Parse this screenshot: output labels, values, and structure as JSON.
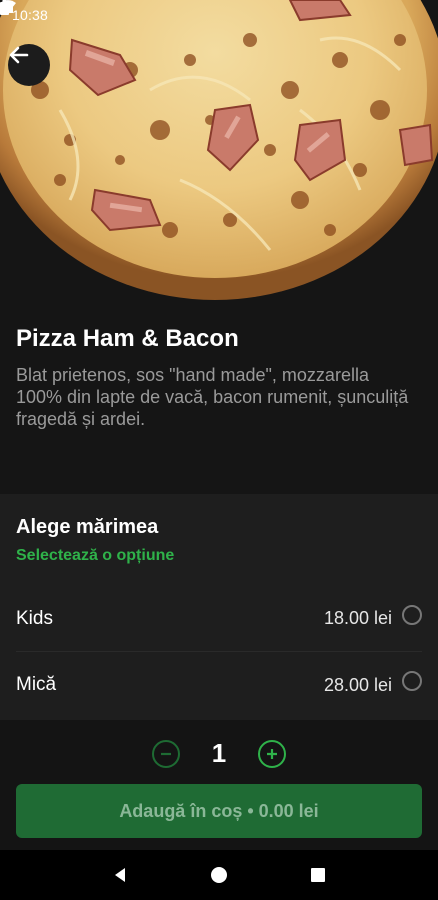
{
  "status_bar": {
    "time": "10:38",
    "left_icons": [
      "android-auto-icon",
      "gear-icon"
    ],
    "right_icons": [
      "wifi-icon",
      "signal-icon",
      "battery-icon"
    ]
  },
  "nav": {
    "back_icon": "arrow-left-icon"
  },
  "product": {
    "name": "Pizza Ham & Bacon",
    "description": "Blat prietenos, sos \"hand made\", mozzarella 100% din lapte de vacă, bacon rumenit, șunculiță fragedă și ardei."
  },
  "size": {
    "title": "Alege mărimea",
    "subtitle": "Selectează o opțiune",
    "options": [
      {
        "label": "Kids",
        "price": "18.00 lei",
        "selected": false
      },
      {
        "label": "Mică",
        "price": "28.00 lei",
        "selected": false
      }
    ]
  },
  "cart": {
    "quantity": "1",
    "minus_icon": "minus-circle-icon",
    "plus_icon": "plus-circle-icon",
    "add_label": "Adaugă în coș • 0.00 lei"
  },
  "colors": {
    "accent_green": "#2fb24a",
    "button_green": "#1f6b34",
    "background": "#151515"
  }
}
